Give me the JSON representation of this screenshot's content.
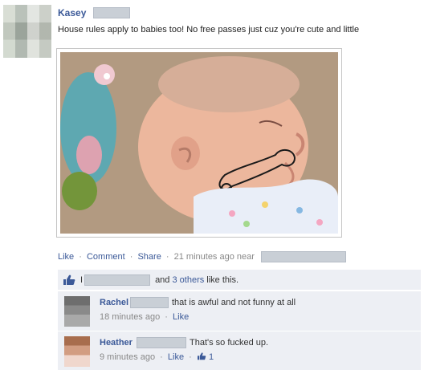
{
  "post": {
    "author": "Kasey",
    "text": "House rules apply to babies too! No free passes just cuz you're cute and little",
    "actions": {
      "like": "Like",
      "comment": "Comment",
      "share": "Share",
      "time": "21 minutes ago near"
    }
  },
  "likes": {
    "prefix": "I",
    "and_text": "and",
    "others_link": "3 others",
    "suffix": "like this."
  },
  "comments": [
    {
      "name": "Rachel",
      "text": "that is awful and not funny at all",
      "time": "18 minutes ago",
      "like_label": "Like"
    },
    {
      "name": "Heather",
      "text": "That's so fucked up.",
      "time": "9 minutes ago",
      "like_label": "Like",
      "like_count": "1"
    }
  ],
  "colors": {
    "link": "#3b5998",
    "meta": "#888888",
    "panel": "#edeff4"
  },
  "icons": {
    "thumbs_up": "thumbs-up-icon"
  }
}
